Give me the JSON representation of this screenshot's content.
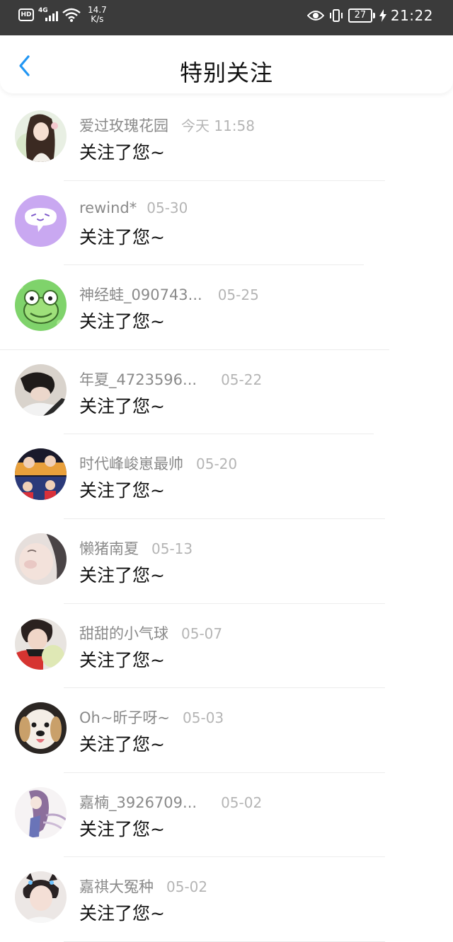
{
  "status_bar": {
    "hd": "HD",
    "network": "4G",
    "speed_value": "14.7",
    "speed_unit": "K/s",
    "battery": "27",
    "time": "21:22"
  },
  "header": {
    "title": "特别关注",
    "back_icon": "chevron-left-icon",
    "accent_color": "#2196f3"
  },
  "items": [
    {
      "name": "爱过玫瑰花园",
      "time": "今天 11:58",
      "message": "关注了您~",
      "avatar": "girl-illustration"
    },
    {
      "name": "rewind*",
      "time": "05-30",
      "message": "关注了您~",
      "avatar": "purple-chat-bubble"
    },
    {
      "name": "神经蛙_090743...",
      "time": "05-25",
      "message": "关注了您~",
      "avatar": "green-frog"
    },
    {
      "name": "年夏_4723596...",
      "time": "05-22",
      "message": "关注了您~",
      "avatar": "person-photo"
    },
    {
      "name": "时代峰峻崽最帅",
      "time": "05-20",
      "message": "关注了您~",
      "avatar": "group-photo"
    },
    {
      "name": "懒猪南夏",
      "time": "05-13",
      "message": "关注了您~",
      "avatar": "face-closeup"
    },
    {
      "name": "甜甜的小气球",
      "time": "05-07",
      "message": "关注了您~",
      "avatar": "boy-balloon"
    },
    {
      "name": "Oh~昕子呀~",
      "time": "05-03",
      "message": "关注了您~",
      "avatar": "puppy"
    },
    {
      "name": "嘉楠_3926709...",
      "time": "05-02",
      "message": "关注了您~",
      "avatar": "anime-girl"
    },
    {
      "name": "嘉祺大冤种",
      "time": "05-02",
      "message": "关注了您~",
      "avatar": "boy-cat-ears"
    }
  ]
}
